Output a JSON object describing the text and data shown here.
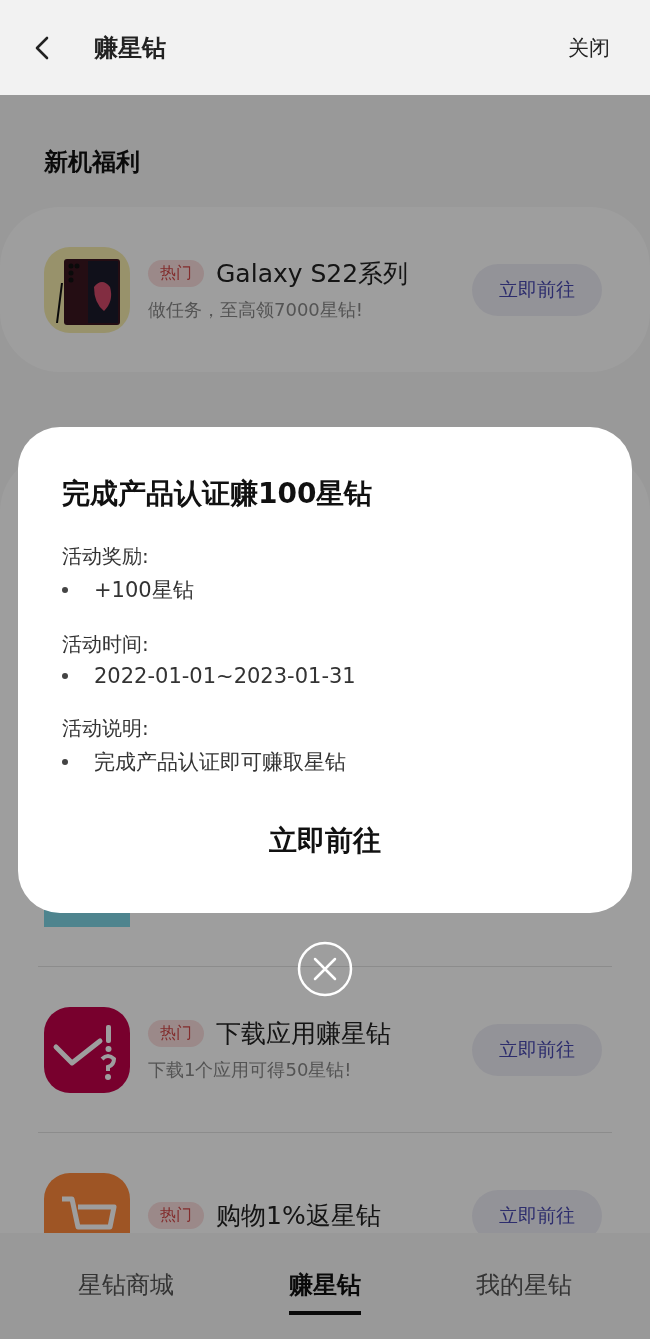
{
  "header": {
    "title": "赚星钻",
    "close": "关闭"
  },
  "sections": [
    {
      "heading": "新机福利",
      "items": [
        {
          "kind": "phone",
          "tag": "热门",
          "title": "Galaxy S22系列",
          "subtitle": "做任务，至高领7000星钻!",
          "action": "立即前往"
        }
      ]
    },
    {
      "items": [
        {
          "kind": "water"
        },
        {
          "kind": "check",
          "tag": "热门",
          "title": "下载应用赚星钻",
          "subtitle": "下载1个应用可得50星钻!",
          "action": "立即前往"
        },
        {
          "kind": "cart",
          "tag": "热门",
          "title": "购物1%返星钻",
          "action": "立即前往"
        }
      ]
    }
  ],
  "tabs": [
    {
      "label": "星钻商城",
      "selected": false
    },
    {
      "label": "赚星钻",
      "selected": true
    },
    {
      "label": "我的星钻",
      "selected": false
    }
  ],
  "dialog": {
    "title": "完成产品认证赚100星钻",
    "sections": [
      {
        "label": "活动奖励:",
        "bullets": [
          "+100星钻"
        ]
      },
      {
        "label": "活动时间:",
        "bullets": [
          "2022-01-01~2023-01-31"
        ]
      },
      {
        "label": "活动说明:",
        "bullets": [
          "完成产品认证即可赚取星钻"
        ]
      }
    ],
    "action": "立即前往"
  }
}
